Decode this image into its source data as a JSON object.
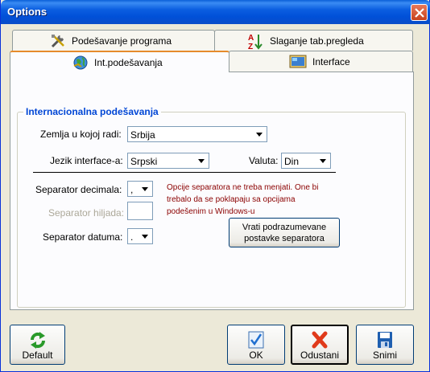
{
  "window": {
    "title": "Options"
  },
  "tabs": {
    "row1": [
      {
        "label": "Podešavanje programa",
        "icon": "tools-icon"
      },
      {
        "label": "Slaganje tab.pregleda",
        "icon": "sort-az-icon"
      }
    ],
    "row2": [
      {
        "label": "Int.podešavanja",
        "icon": "globe-icon"
      },
      {
        "label": "Interface",
        "icon": "monitor-icon"
      }
    ]
  },
  "group": {
    "title": "Internacionalna podešavanja"
  },
  "fields": {
    "country_label": "Zemlja u kojoj radi:",
    "country_value": "Srbija",
    "language_label": "Jezik interface-a:",
    "language_value": "Srpski",
    "currency_label": "Valuta:",
    "currency_value": "Din",
    "decimal_label": "Separator decimala:",
    "decimal_value": ",",
    "thousands_label": "Separator hiljada:",
    "thousands_value": "",
    "date_label": "Separator datuma:",
    "date_value": "."
  },
  "note": "Opcije separatora ne treba menjati. One bi trebalo da se poklapaju sa opcijama podešenim u Windows-u",
  "revert_button": {
    "line1": "Vrati podrazumevane",
    "line2": "postavke separatora"
  },
  "buttons": {
    "default": "Default",
    "ok": "OK",
    "cancel": "Odustani",
    "save": "Snimi"
  },
  "colors": {
    "titlebar": "#0054e3",
    "group_title": "#0046d5",
    "note": "#8b0000"
  }
}
